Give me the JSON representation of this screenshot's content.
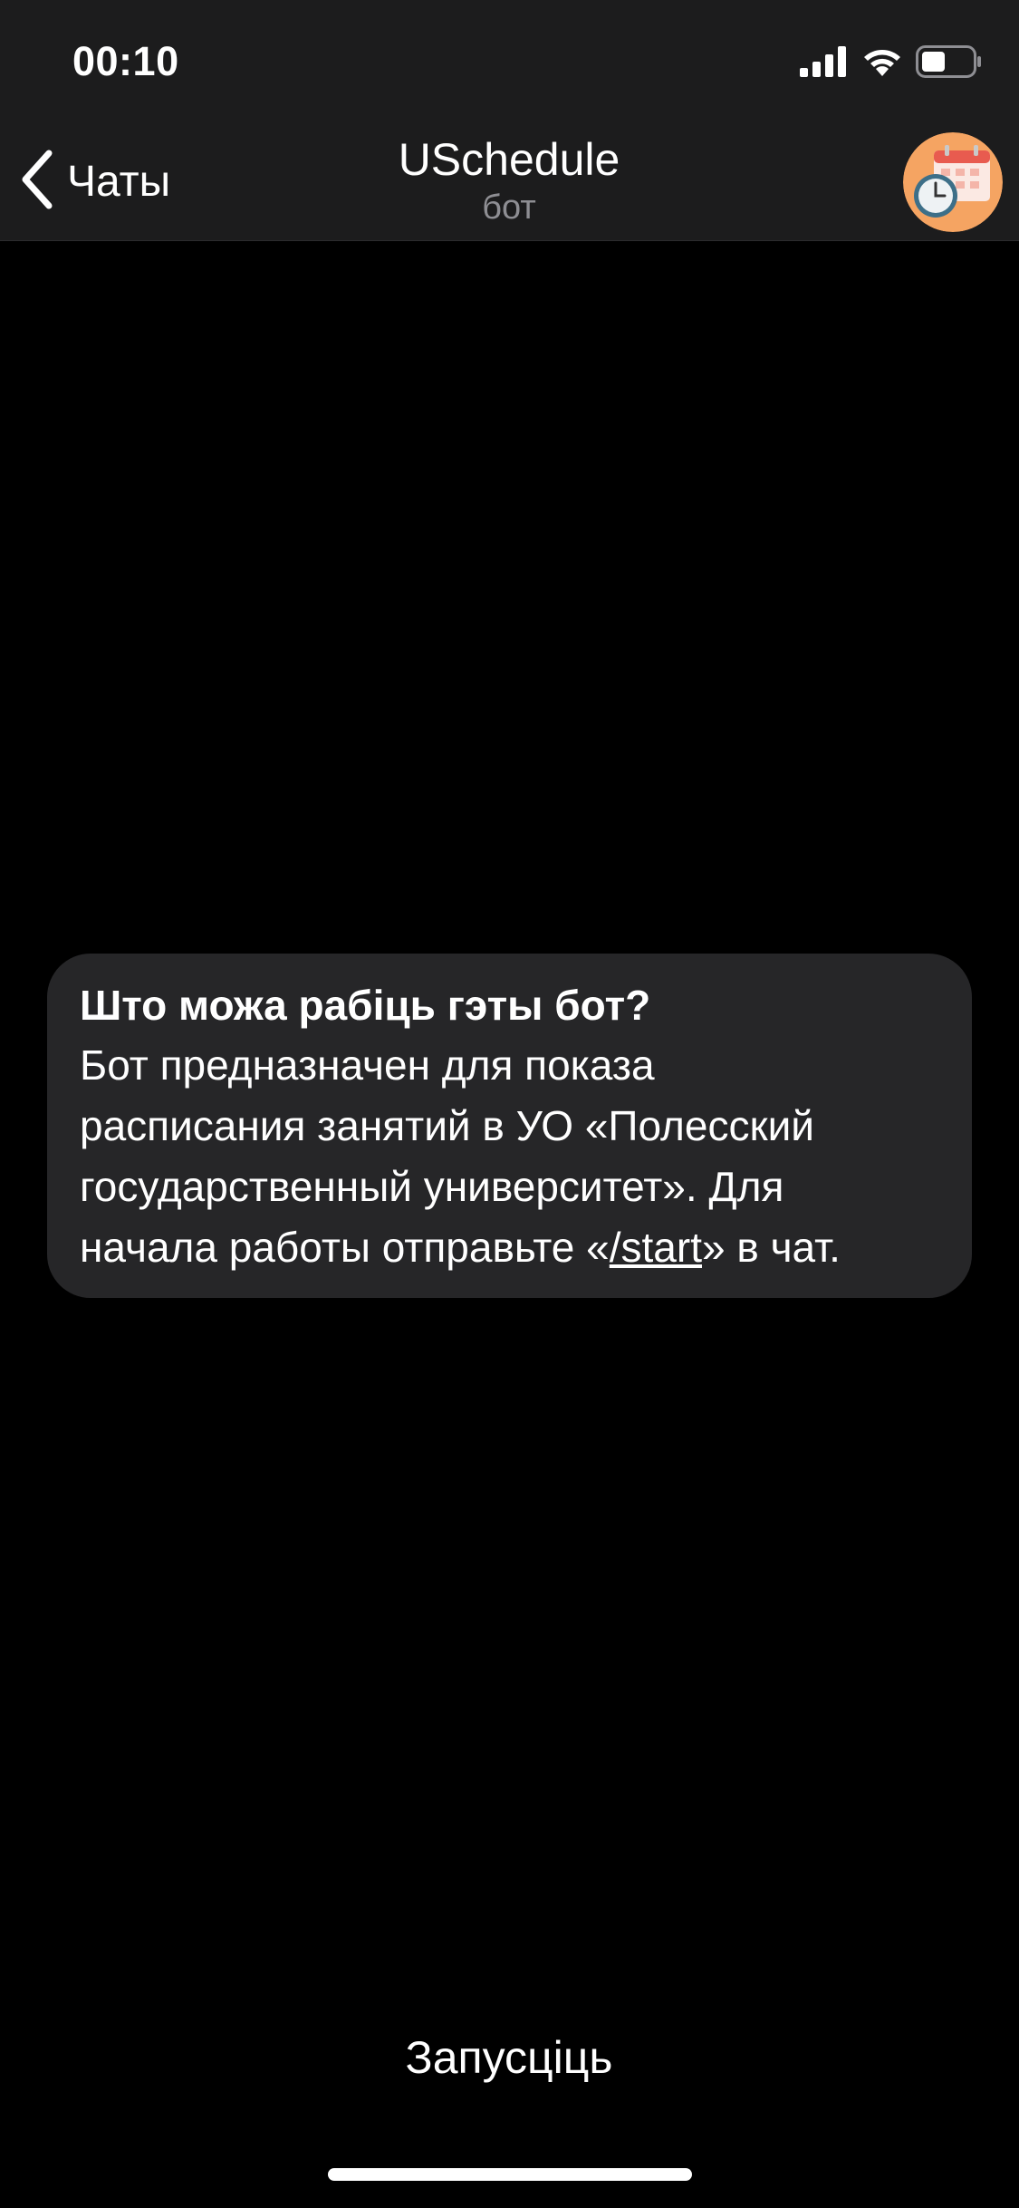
{
  "status_bar": {
    "time": "00:10",
    "icons": [
      "cellular-signal-icon",
      "wifi-icon",
      "battery-icon"
    ]
  },
  "nav": {
    "back_label": "Чаты",
    "title": "USchedule",
    "subtitle": "бот",
    "avatar_icon": "calendar-clock-avatar-icon"
  },
  "info_card": {
    "title": "Што можа рабіць гэты бот?",
    "body_line1": "Бот предназначен для показа",
    "body_line2": "расписания занятий в УО «Полесский",
    "body_line3": "государственный университет». Для",
    "body_line4_prefix": "начала работы отправьте «",
    "body_line4_link": "/start",
    "body_line4_suffix": "» в чат."
  },
  "start_button": {
    "label": "Запусціць"
  },
  "colors": {
    "background": "#000000",
    "header_background": "#1c1c1d",
    "card_background": "#262628",
    "subtitle_gray": "#8e8e93",
    "avatar_orange": "#f5a462",
    "calendar_red": "#e85b4f"
  }
}
